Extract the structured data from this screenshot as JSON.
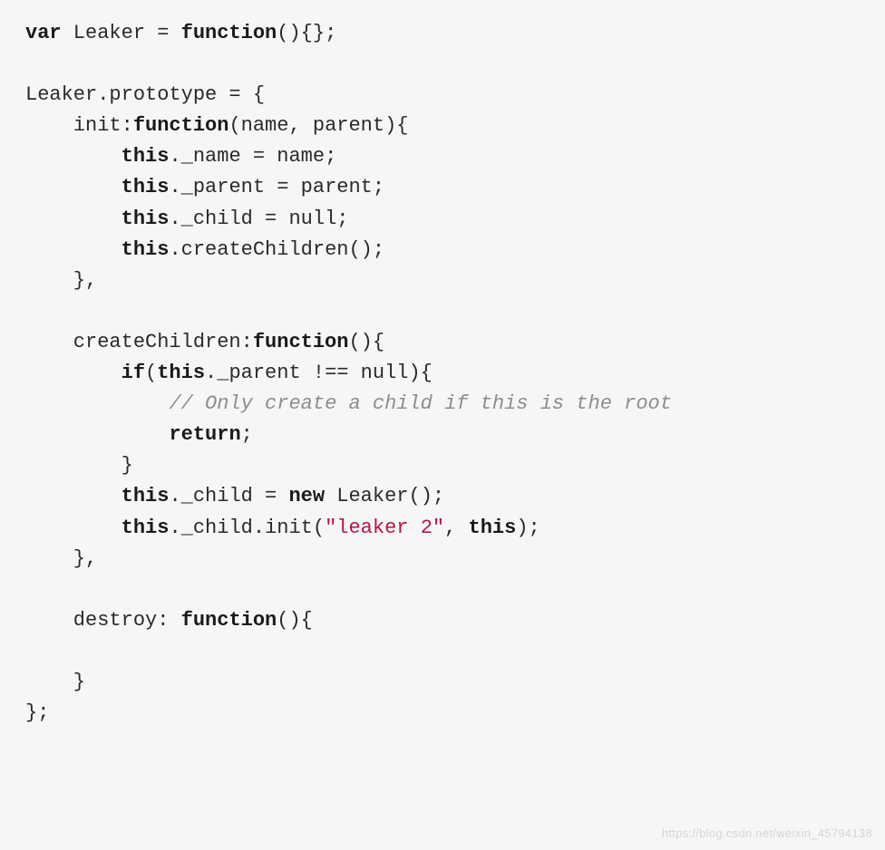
{
  "code": {
    "line1_var": "var",
    "line1_rest": " Leaker = ",
    "line1_func": "function",
    "line1_end": "(){};",
    "line3": "Leaker.prototype = {",
    "line4_pre": "    init:",
    "line4_func": "function",
    "line4_post": "(name, parent){",
    "line5_pre": "        ",
    "line5_this": "this",
    "line5_post": "._name = name;",
    "line6_pre": "        ",
    "line6_this": "this",
    "line6_post": "._parent = parent;",
    "line7_pre": "        ",
    "line7_this": "this",
    "line7_post": "._child = null;",
    "line8_pre": "        ",
    "line8_this": "this",
    "line8_post": ".createChildren();",
    "line9": "    },",
    "line11_pre": "    createChildren:",
    "line11_func": "function",
    "line11_post": "(){",
    "line12_pre": "        ",
    "line12_if": "if",
    "line12_mid": "(",
    "line12_this": "this",
    "line12_post": "._parent !== null){",
    "line13_pre": "            ",
    "line13_comment": "// Only create a child if this is the root",
    "line14_pre": "            ",
    "line14_return": "return",
    "line14_post": ";",
    "line15": "        }",
    "line16_pre": "        ",
    "line16_this": "this",
    "line16_mid": "._child = ",
    "line16_new": "new",
    "line16_post": " Leaker();",
    "line17_pre": "        ",
    "line17_this": "this",
    "line17_mid": "._child.init(",
    "line17_str": "\"leaker 2\"",
    "line17_mid2": ", ",
    "line17_this2": "this",
    "line17_post": ");",
    "line18": "    },",
    "line20_pre": "    destroy: ",
    "line20_func": "function",
    "line20_post": "(){",
    "line22": "    }",
    "line23": "};"
  },
  "watermark": "https://blog.csdn.net/weixin_45794138"
}
